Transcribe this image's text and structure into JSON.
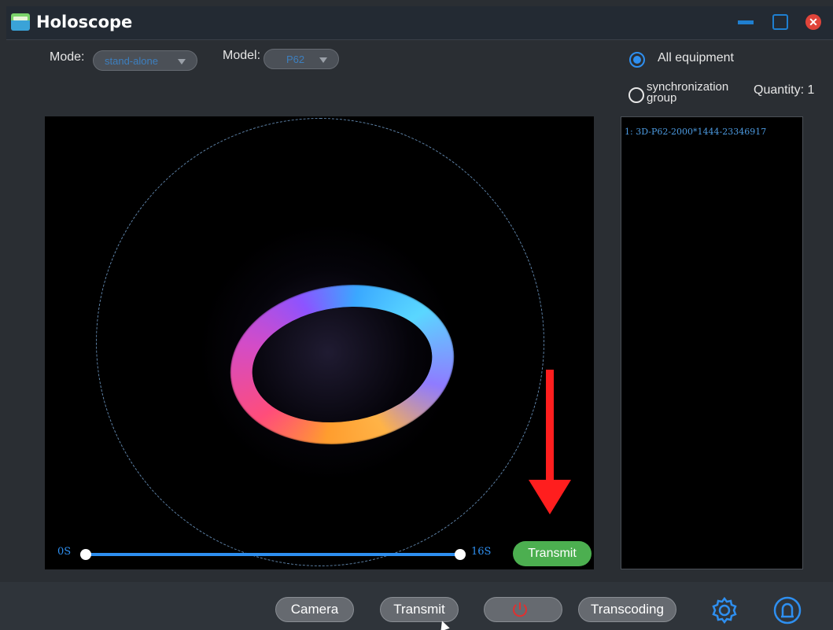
{
  "window": {
    "title": "Holoscope",
    "icon": "app-logo-icon",
    "controls": [
      "minimize-icon",
      "maximize-icon",
      "close-icon"
    ]
  },
  "header": {
    "mode_label": "Mode:",
    "mode_value": "stand-alone",
    "model_label": "Model:",
    "model_value": "P62"
  },
  "target": {
    "all_equipment_label": "All equipment",
    "all_equipment_selected": true,
    "sync_group_label": "synchronization group",
    "sync_group_selected": false,
    "quantity_label": "Quantity: 1"
  },
  "device_list": [
    {
      "label": "1:  3D-P62-2000*1444-23346917"
    }
  ],
  "preview": {
    "timeline_start": "0S",
    "timeline_end": "16S",
    "transmit_label": "Transmit"
  },
  "toolbar": {
    "camera_label": "Camera",
    "transmit_label": "Transmit",
    "power_icon": "power-icon",
    "transcoding_label": "Transcoding",
    "settings_icon": "gear-icon",
    "help_icon": "help-icon"
  },
  "colors": {
    "accent": "#2e8ff0",
    "transmit_green": "#4caf50",
    "annotation_red": "#ff1e1e"
  }
}
